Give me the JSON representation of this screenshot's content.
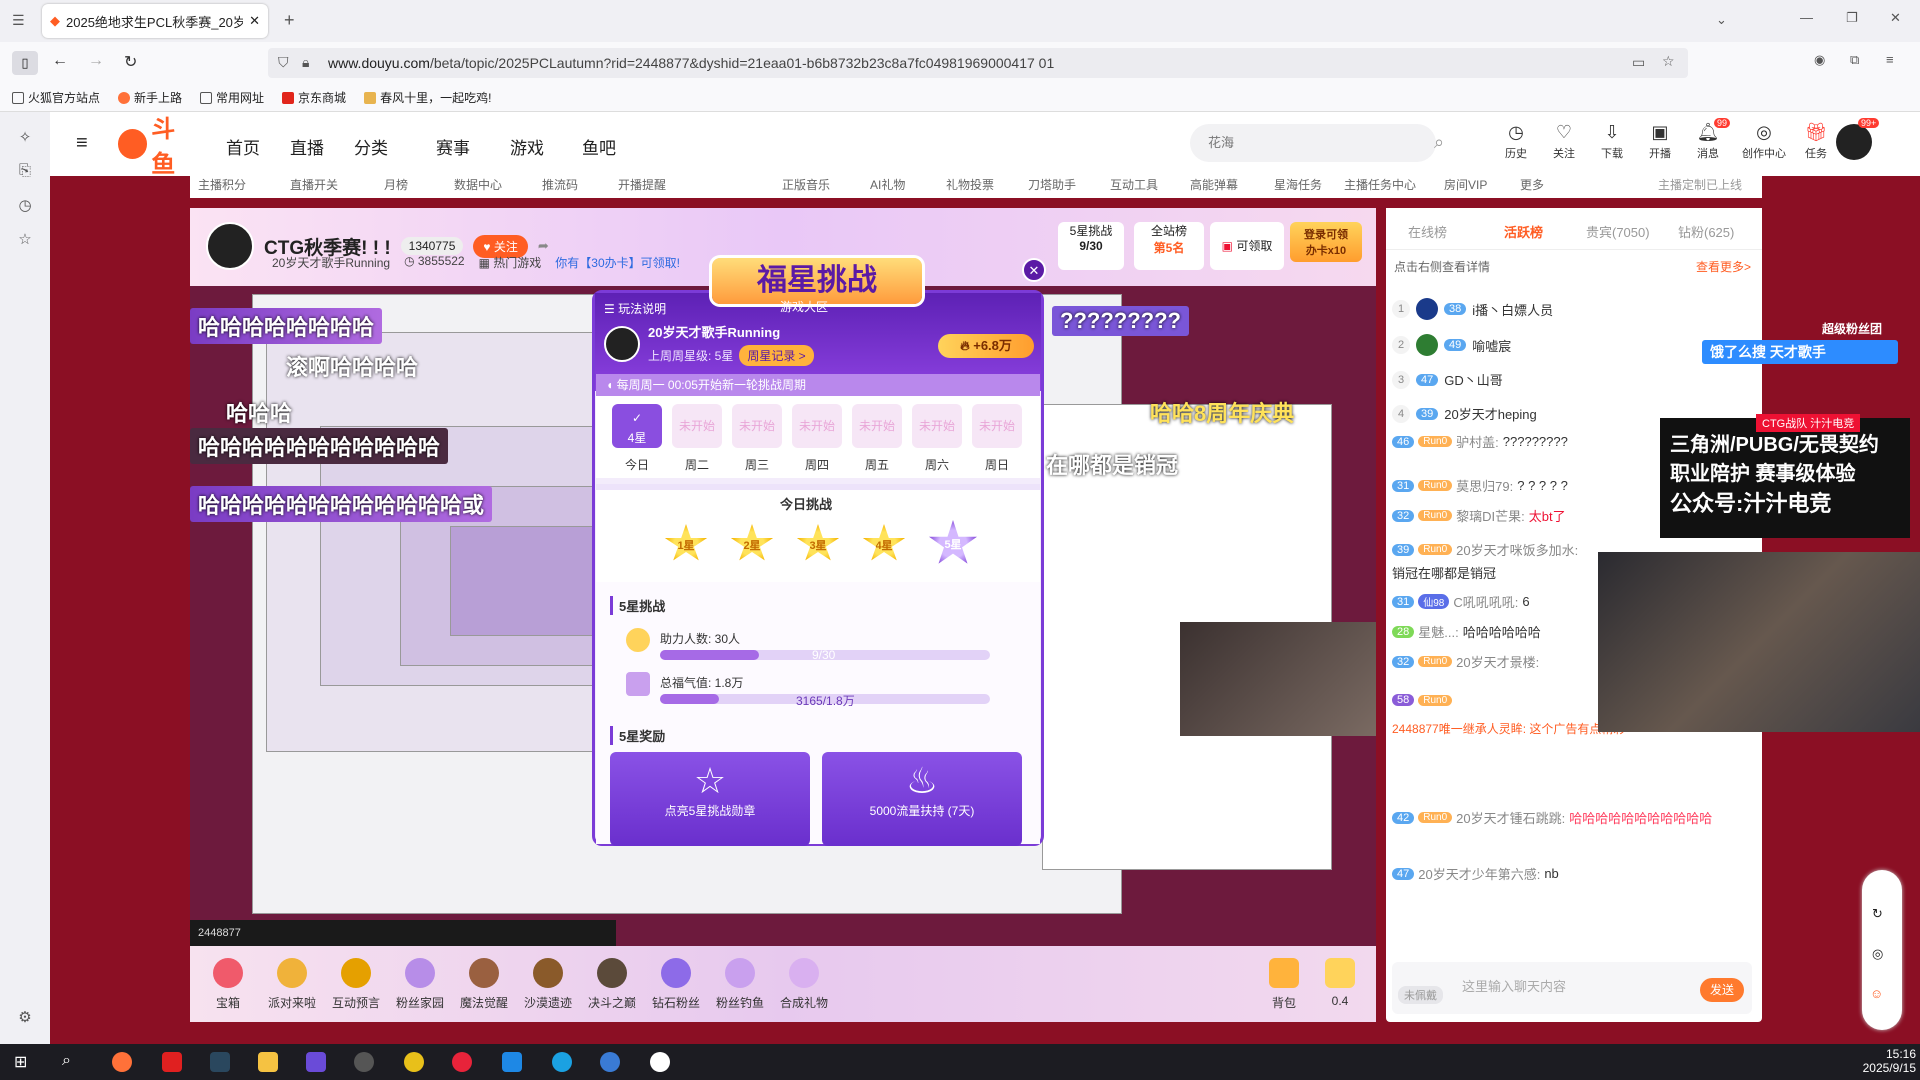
{
  "browser": {
    "tab_title": "2025绝地求生PCL秋季赛_20岁",
    "url_prefix": "www.douyu.com",
    "url_path": "/beta/topic/2025PCLautumn?rid=2448877&dyshid=21eaa01-b6b8732b23c8a7fc04981969000417 01",
    "bookmarks": [
      "火狐官方站点",
      "新手上路",
      "常用网址",
      "京东商城",
      "春风十里，一起吃鸡!"
    ]
  },
  "site": {
    "logo": "斗鱼",
    "logo_sub": "DOUYU.COM",
    "nav": [
      "首页",
      "直播",
      "分类",
      "赛事",
      "游戏",
      "鱼吧"
    ],
    "search_placeholder": "花海",
    "header_icons": [
      "历史",
      "关注",
      "下载",
      "开播",
      "消息",
      "创作中心",
      "任务"
    ],
    "message_badge": "99",
    "avatar_badge": "99+",
    "subnav": [
      "主播积分",
      "直播开关",
      "月榜",
      "数据中心",
      "推流码",
      "开播提醒",
      "正版音乐",
      "AI礼物",
      "礼物投票",
      "刀塔助手",
      "互动工具",
      "高能弹幕",
      "星海任务",
      "主播任务中心",
      "房间VIP",
      "更多",
      "主播定制已上线"
    ]
  },
  "room": {
    "title": "CTG秋季赛! ! !",
    "followers": "1340775",
    "follow_label": "关注",
    "streamer_name": "20岁天才歌手Running",
    "viewers": "3855522",
    "category": "热门游戏",
    "card_label": "你有【30办卡】可领取!",
    "badge_title": "5星挑战",
    "badge_value": "9/30",
    "rank_title": "全站榜",
    "rank_value": "第5名",
    "claim_label": "可领取",
    "login_label": "登录可领",
    "login_sub": "办卡x10",
    "room_id": "2448877"
  },
  "danmu": [
    "哈哈哈哈哈哈哈哈",
    "滚啊哈哈哈哈",
    "哈哈哈哈哈哈哈哈哈哈哈",
    "哈哈哈哈哈哈哈哈哈哈哈哈或",
    "哈哈哈",
    "?????????",
    "在哪都是销冠",
    "哈哈8周年庆典"
  ],
  "popup": {
    "title": "福星挑战",
    "subtitle": "游戏大区",
    "rules": "玩法说明",
    "user": "20岁天才歌手Running",
    "last_week": "上周周星级: 5星",
    "record_btn": "周星记录 >",
    "boost": "+6.8万",
    "notice": "每周周一 00:05开始新一轮挑战周期",
    "days": [
      {
        "status": "4星",
        "label": "今日",
        "current": true
      },
      {
        "status": "未开始",
        "label": "周二",
        "current": false
      },
      {
        "status": "未开始",
        "label": "周三",
        "current": false
      },
      {
        "status": "未开始",
        "label": "周四",
        "current": false
      },
      {
        "status": "未开始",
        "label": "周五",
        "current": false
      },
      {
        "status": "未开始",
        "label": "周六",
        "current": false
      },
      {
        "status": "未开始",
        "label": "周日",
        "current": false
      }
    ],
    "today_title": "今日挑战",
    "stars": [
      "1星",
      "2星",
      "3星",
      "4星",
      "5星"
    ],
    "challenge_title": "5星挑战",
    "helpers_label": "助力人数: 30人",
    "helpers_progress": "9/30",
    "helpers_fraction": 0.3,
    "heat_label": "总福气值: 1.8万",
    "heat_progress": "3165/1.8万",
    "heat_fraction": 0.18,
    "reward_title": "5星奖励",
    "rewards": [
      "点亮5星挑战勋章",
      "5000流量扶持 (7天)"
    ]
  },
  "gifts": [
    "宝箱",
    "派对来啦",
    "互动预言",
    "粉丝家园",
    "魔法觉醒",
    "沙漠遗迹",
    "决斗之巅",
    "钻石粉丝",
    "粉丝钓鱼",
    "合成礼物",
    "背包",
    "0.4"
  ],
  "chat": {
    "tabs": [
      "在线榜",
      "活跃榜",
      "贵宾(7050)",
      "钻粉(625)"
    ],
    "hint": "点击右侧查看详情",
    "more": "查看更多>",
    "ranking": [
      {
        "rank": "1",
        "level": "38",
        "name": "i播丶白嫖人员"
      },
      {
        "rank": "2",
        "level": "49",
        "name": "喻嘘宸"
      },
      {
        "rank": "3",
        "level": "47",
        "name": "GD丶山哥"
      },
      {
        "rank": "4",
        "level": "39",
        "name": "20岁天才heping"
      }
    ],
    "messages": [
      {
        "level": "46",
        "fan": "Run0",
        "user": "驴村盖:",
        "text": "?????????"
      },
      {
        "level": "31",
        "fan": "Run0",
        "user": "莫思归79:",
        "text": "? ? ? ? ?"
      },
      {
        "level": "32",
        "fan": "Run0",
        "user": "黎璃DI芒果:",
        "text": "太bt了"
      },
      {
        "level": "39",
        "fan": "Run0",
        "user": "20岁天才咪饭多加水:",
        "text": "销冠在哪都是销冠"
      },
      {
        "level": "31",
        "fan": "仙98",
        "user": "C吼吼吼吼:",
        "text": "6"
      },
      {
        "level": "28",
        "fan": "",
        "user": "星魅...:",
        "text": "哈哈哈哈哈哈"
      },
      {
        "level": "32",
        "fan": "Run0",
        "user": "20岁天才景楼:",
        "text": ""
      },
      {
        "level": "58",
        "fan": "Run0",
        "user": "",
        "text": ""
      },
      {
        "level": "42",
        "fan": "Run0",
        "user": "20岁天才锺石跳跳:",
        "text": "哈哈哈哈哈哈哈哈哈哈哈"
      },
      {
        "level": "47",
        "fan": "",
        "user": "20岁天才少年第六感:",
        "text": "nb"
      }
    ],
    "system": "2448877唯一继承人灵眸: 这个广告有点精彩",
    "input_placeholder": "这里输入聊天内容",
    "unknown_label": "未佩戴",
    "send": "发送"
  },
  "ads": {
    "search_ad": "饿了么搜 天才歌手",
    "super_fan": "超级粉丝团",
    "banner_line1": "三角洲/PUBG/无畏契约",
    "banner_line2": "职业陪护 赛事级体验",
    "banner_line3": "公众号:汁汁电竞",
    "ctg": "CTG战队 汁汁电竞"
  },
  "taskbar": {
    "time": "15:16",
    "date": "2025/9/15"
  }
}
